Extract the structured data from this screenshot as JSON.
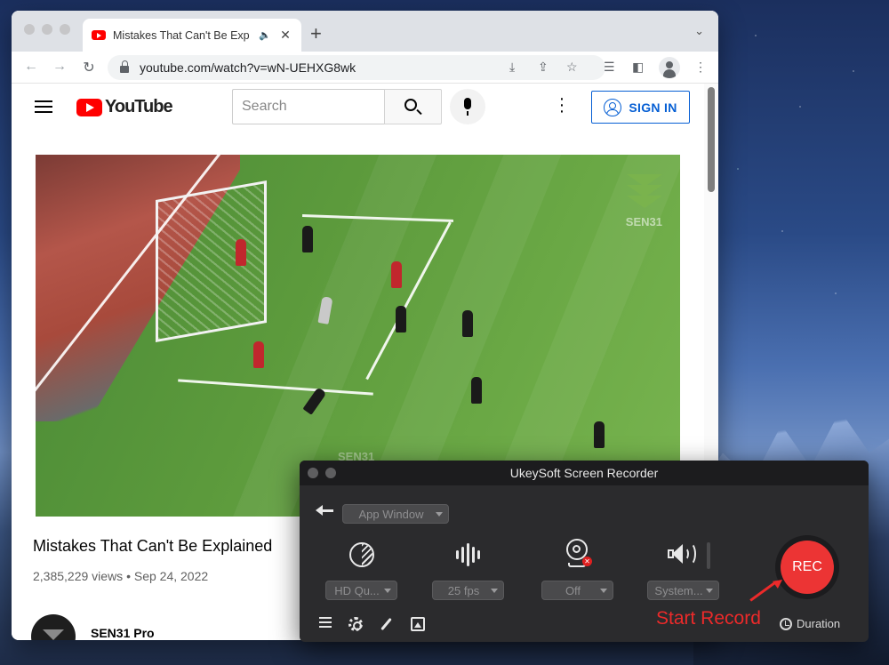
{
  "browser": {
    "tab": {
      "title": "Mistakes That Can't Be Exp",
      "favicon": "youtube-favicon",
      "audio_icon": "🔈",
      "close_icon": "✕"
    },
    "new_tab_icon": "+",
    "tab_menu_icon": "⌄",
    "nav": {
      "back_icon": "←",
      "forward_icon": "→",
      "reload_icon": "↻"
    },
    "url": "youtube.com/watch?v=wN-UEHXG8wk",
    "omnibox_icons": [
      "install-icon",
      "share-icon",
      "star-icon"
    ],
    "toolbar_icons": [
      "reading-list-icon",
      "side-panel-icon",
      "profile-icon",
      "menu-icon"
    ]
  },
  "youtube": {
    "logo_text": "YouTube",
    "search_placeholder": "Search",
    "sign_in_label": "SIGN IN",
    "video": {
      "watermark_text": "SEN31",
      "bottom_text": "SEN31",
      "title": "Mistakes That Can't Be Explained",
      "meta": "2,385,229 views • Sep 24, 2022"
    },
    "channel": {
      "name": "SEN31 Pro"
    }
  },
  "recorder": {
    "title": "UkeySoft Screen Recorder",
    "mode_select": "App Window",
    "quality_select": "HD Qu...",
    "fps_select": "25 fps",
    "camera_select": "Off",
    "audio_select": "System...",
    "rec_label": "REC",
    "duration_label": "Duration",
    "annotation": "Start Record",
    "colors": {
      "rec": "#ec3434",
      "annotation": "#ec2a2a",
      "panel": "#2b2b2d"
    }
  }
}
